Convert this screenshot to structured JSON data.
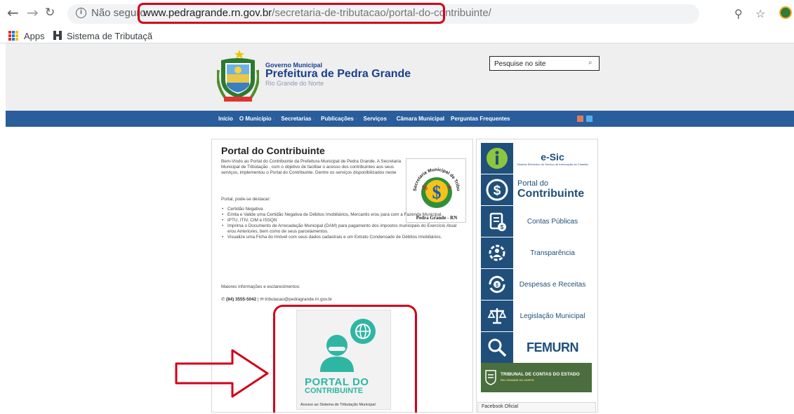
{
  "browser": {
    "not_secure_label": "Não seguro",
    "url_host": "www.pedragrande.rn.gov.br",
    "url_path": "/secretaria-de-tributacao/portal-do-contribuinte/",
    "bookmarks": [
      {
        "label": "Apps"
      },
      {
        "label": "Sistema de Tributaçã"
      }
    ]
  },
  "site": {
    "gov_label": "Governo Municipal",
    "title": "Prefeitura de Pedra Grande",
    "state": "Rio Grande do Norte",
    "search_placeholder": "Pesquise no site"
  },
  "nav": {
    "items": [
      {
        "label": "Início",
        "caret": ""
      },
      {
        "label": "O Município",
        "caret": "·"
      },
      {
        "label": "Secretarias",
        "caret": "·"
      },
      {
        "label": "Publicações",
        "caret": "·"
      },
      {
        "label": "Serviços",
        "caret": "·"
      },
      {
        "label": "Câmara Municipal",
        "caret": ""
      },
      {
        "label": "Perguntas Frequentes",
        "caret": ""
      }
    ]
  },
  "content": {
    "title": "Portal do Contribuinte",
    "intro": "Bem-Vindo ao Portal do Contribuinte da Prefeitura Municipal de Pedra Grande. A Secretaria Municipal de Tributação , com o objetivo de facilitar o acesso dos contribuintes aos seus serviços, implementou o Portal do Contribuinte. Dentre os serviços disponibilizados neste",
    "highlight_label": "Portal, pode-se destacar:",
    "bullets": [
      "Certidão Negativa",
      "Emita e Valide uma Certidão Negativa de Débitos Imobiliários, Mercantis e/ou para com a Fazenda Municipal.",
      "IPTU, ITIV, CIM e ISSQN",
      "Imprima o Documento de Arrecadação Municipal (DAM) para pagamento dos impostos municipais do Exercício Atual e/ou Anteriores, bem como de seus parcelamentos.",
      "Visualize uma Ficha do Imóvel com seus dados cadastrais e um Extrato Condensado de Débitos Imobiliários."
    ],
    "more_info": "Maiores informações e esclarecimentos:",
    "phone": "(84) 3555-5042",
    "email": "tributacao@pedragrande.rn.gov.br",
    "tax_logo_top": "Secretaria Municipal de Tributação",
    "tax_logo_bottom": "Pedra Grande - RN",
    "banner": {
      "line1": "PORTAL DO",
      "line2": "CONTRIBUINTE",
      "caption": "Acesso ao Sistema de Tributação Municipal"
    }
  },
  "sidebar": {
    "esic_title": "e-Sic",
    "esic_sub": "Sistema Eletrônico do Serviço de Informação ao Cidadão",
    "contrib_small": "Portal do",
    "contrib_big": "Contribuinte",
    "items": [
      {
        "label": "Contas Públicas"
      },
      {
        "label": "Transparência"
      },
      {
        "label": "Despesas e Receitas"
      },
      {
        "label": "Legislação Municipal"
      }
    ],
    "femurn": "FEMURN",
    "tce": "TRIBUNAL DE CONTAS DO ESTADO",
    "tce_sub": "RIO GRANDE DO NORTE",
    "facebook": "Facebook Oficial"
  },
  "colors": {
    "nav_blue": "#2a5d9c",
    "side_blue": "#1f4f7a",
    "annotation_red": "#d0021b",
    "portal_teal": "#2fb6a3"
  }
}
